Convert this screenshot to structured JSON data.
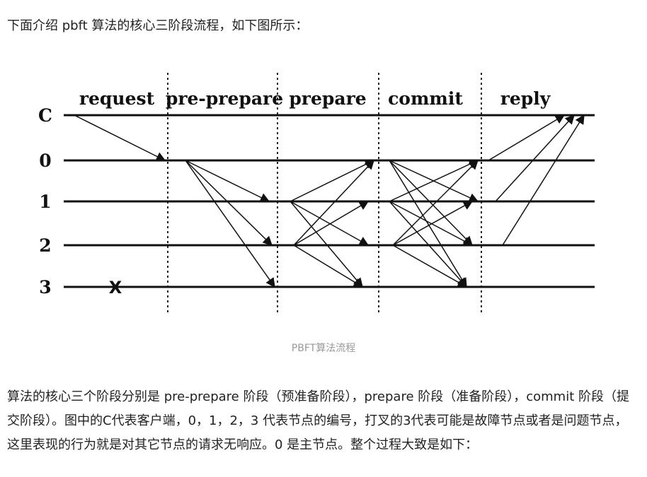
{
  "intro_text": "下面介绍 pbft 算法的核心三阶段流程，如下图所示：",
  "figure": {
    "caption": "PBFT算法流程",
    "phases": [
      "request",
      "pre-prepare",
      "prepare",
      "commit",
      "reply"
    ],
    "nodes": [
      "C",
      "0",
      "1",
      "2",
      "3"
    ],
    "faulty_mark": "X",
    "messages": {
      "request": [
        [
          "C",
          "0"
        ]
      ],
      "pre_prepare": [
        [
          "0",
          "1"
        ],
        [
          "0",
          "2"
        ],
        [
          "0",
          "3"
        ]
      ],
      "prepare": [
        [
          "1",
          "0"
        ],
        [
          "1",
          "2"
        ],
        [
          "1",
          "3"
        ],
        [
          "2",
          "0"
        ],
        [
          "2",
          "1"
        ],
        [
          "2",
          "3"
        ]
      ],
      "commit": [
        [
          "0",
          "1"
        ],
        [
          "0",
          "2"
        ],
        [
          "0",
          "3"
        ],
        [
          "1",
          "0"
        ],
        [
          "1",
          "2"
        ],
        [
          "1",
          "3"
        ],
        [
          "2",
          "0"
        ],
        [
          "2",
          "1"
        ],
        [
          "2",
          "3"
        ]
      ],
      "reply": [
        [
          "0",
          "C"
        ],
        [
          "1",
          "C"
        ],
        [
          "2",
          "C"
        ]
      ]
    }
  },
  "body_text": "算法的核心三个阶段分别是 pre-prepare 阶段（预准备阶段），prepare 阶段（准备阶段），commit 阶段（提交阶段）。图中的C代表客户端，0，1，2，3 代表节点的编号，打叉的3代表可能是故障节点或者是问题节点，这里表现的行为就是对其它节点的请求无响应。0 是主节点。整个过程大致是如下："
}
